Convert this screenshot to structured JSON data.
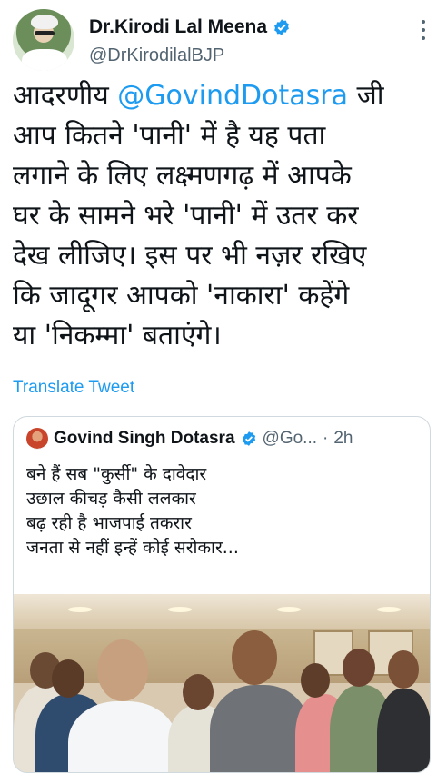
{
  "tweet": {
    "display_name": "Dr.Kirodi Lal Meena",
    "handle": "@DrKirodilalBJP",
    "text_prefix": "आदरणीय ",
    "mention": "@GovindDotasra",
    "text_lines": [
      " जी",
      "आप कितने 'पानी' में है यह पता",
      "लगाने के लिए लक्ष्मणगढ़ में आपके",
      "घर के सामने भरे 'पानी' में उतर कर",
      "देख लीजिए। इस पर भी नज़र रखिए",
      "कि जादूगर आपको 'नाकारा' कहेंगे",
      "या 'निकम्मा' बताएंगे।"
    ],
    "translate_label": "Translate Tweet",
    "verified_icon": "verified-badge-icon",
    "more_icon": "more-options-icon"
  },
  "quote": {
    "display_name": "Govind Singh Dotasra",
    "handle": "@Go...",
    "separator": "·",
    "time": "2h",
    "lines": [
      "बने हैं सब \"कुर्सी\" के दावेदार",
      "उछाल कीचड़ कैसी ललकार",
      "बढ़ रही है भाजपाई तकरार",
      "जनता से नहीं इन्हें कोई सरोकार..."
    ]
  },
  "colors": {
    "accent": "#1d9bf0",
    "text": "#0f1419",
    "secondary": "#536471",
    "border": "#cfd9de"
  }
}
